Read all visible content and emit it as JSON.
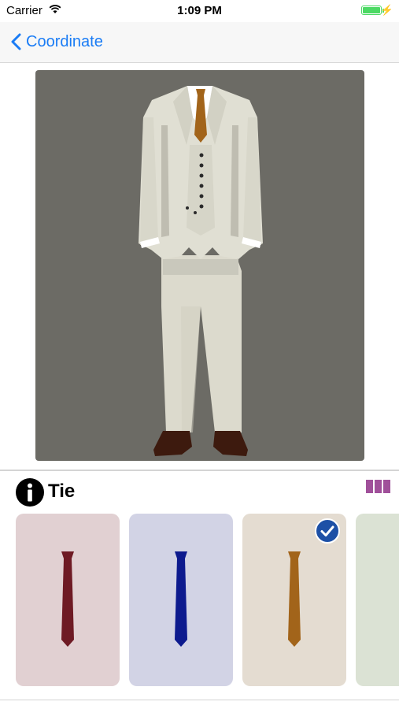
{
  "status_bar": {
    "carrier": "Carrier",
    "time": "1:09 PM"
  },
  "nav": {
    "back_label": "Coordinate"
  },
  "section": {
    "title": "Tie",
    "icon": "info-icon",
    "layout_icon": "grid-icon"
  },
  "tie_cards": [
    {
      "name": "red-tie",
      "background": "#e1d0d2",
      "tie_color": "#6e1a24",
      "selected": false
    },
    {
      "name": "blue-tie",
      "background": "#d2d3e5",
      "tie_color": "#0d1a8e",
      "selected": false
    },
    {
      "name": "gold-tie",
      "background": "#e4dcd1",
      "tie_color": "#a2641a",
      "selected": true
    },
    {
      "name": "green-tie",
      "background": "#dbe2d4",
      "tie_color": "#3d6b2a",
      "selected": false
    }
  ],
  "colors": {
    "accent": "#1a7cf5",
    "grid_icon": "#a0509a",
    "check": "#1d50a6"
  }
}
